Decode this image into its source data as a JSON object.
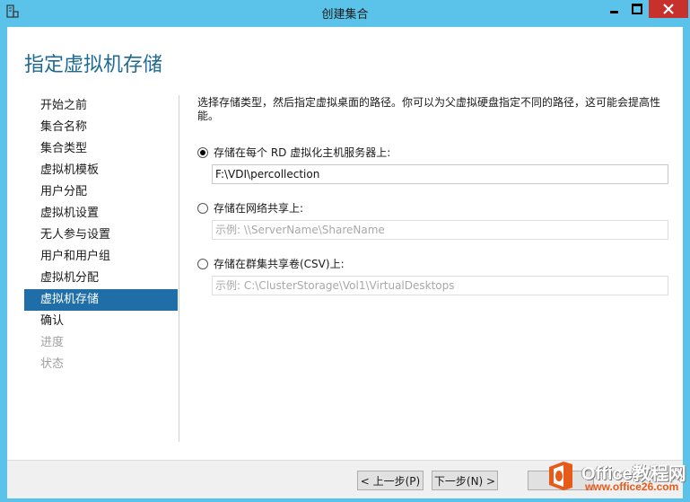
{
  "window": {
    "title": "创建集合"
  },
  "page": {
    "title": "指定虚拟机存储",
    "description": "选择存储类型，然后指定虚拟桌面的路径。你可以为父虚拟硬盘指定不同的路径，这可能会提高性能。"
  },
  "steps": [
    {
      "label": "开始之前",
      "state": "normal"
    },
    {
      "label": "集合名称",
      "state": "normal"
    },
    {
      "label": "集合类型",
      "state": "normal"
    },
    {
      "label": "虚拟机模板",
      "state": "normal"
    },
    {
      "label": "用户分配",
      "state": "normal"
    },
    {
      "label": "虚拟机设置",
      "state": "normal"
    },
    {
      "label": "无人参与设置",
      "state": "normal"
    },
    {
      "label": "用户和用户组",
      "state": "normal"
    },
    {
      "label": "虚拟机分配",
      "state": "normal"
    },
    {
      "label": "虚拟机存储",
      "state": "active"
    },
    {
      "label": "确认",
      "state": "normal"
    },
    {
      "label": "进度",
      "state": "disabled"
    },
    {
      "label": "状态",
      "state": "disabled"
    }
  ],
  "options": {
    "local": {
      "label": "存储在每个 RD 虚拟化主机服务器上:",
      "selected": true,
      "value": "F:\\VDI\\percollection"
    },
    "share": {
      "label": "存储在网络共享上:",
      "selected": false,
      "placeholder": "示例: \\\\ServerName\\ShareName"
    },
    "csv": {
      "label": "存储在群集共享卷(CSV)上:",
      "selected": false,
      "placeholder": "示例: C:\\ClusterStorage\\Vol1\\VirtualDesktops"
    }
  },
  "buttons": {
    "prev": "< 上一步(P)",
    "next": "下一步(N) >",
    "cancel": "取消"
  },
  "watermark": {
    "brand": "Office教程网",
    "url": "www.office26.com"
  },
  "colors": {
    "titlebar": "#5bc3e9",
    "accent": "#1f6ea8",
    "heading": "#1f6a92",
    "close": "#c7302b",
    "watermark_orange": "#e85a1a"
  },
  "icons": {
    "app": "server-manager-icon",
    "minimize": "minimize-icon",
    "maximize": "maximize-icon",
    "close": "close-icon"
  }
}
